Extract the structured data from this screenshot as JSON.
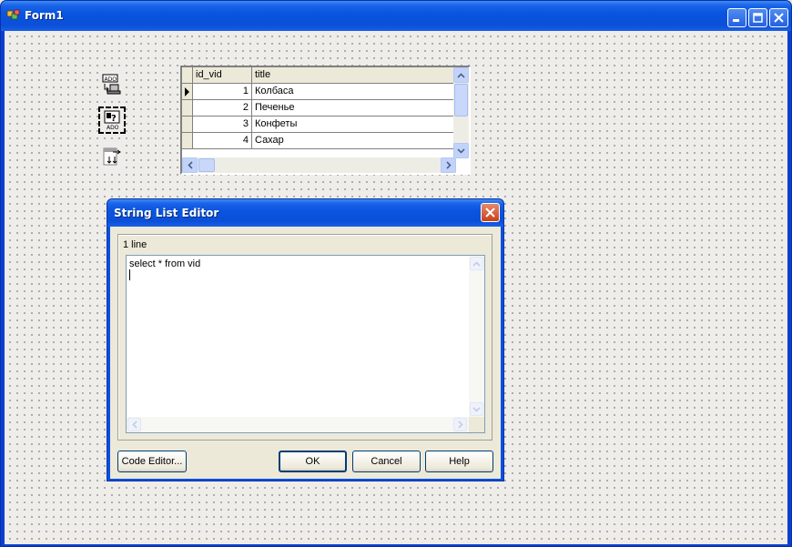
{
  "window": {
    "title": "Form1"
  },
  "grid": {
    "columns": [
      "id_vid",
      "title"
    ],
    "rows": [
      {
        "id": "1",
        "title": "Колбаса"
      },
      {
        "id": "2",
        "title": "Печенье"
      },
      {
        "id": "3",
        "title": "Конфеты"
      },
      {
        "id": "4",
        "title": "Сахар"
      }
    ]
  },
  "dialog": {
    "title": "String List Editor",
    "line_count": "1 line",
    "memo_text": "select * from vid",
    "buttons": {
      "code_editor": "Code Editor...",
      "ok": "OK",
      "cancel": "Cancel",
      "help": "Help"
    }
  },
  "colors": {
    "xp_blue": "#0a55e0",
    "face": "#ece9d8",
    "close_red": "#c8401a"
  }
}
